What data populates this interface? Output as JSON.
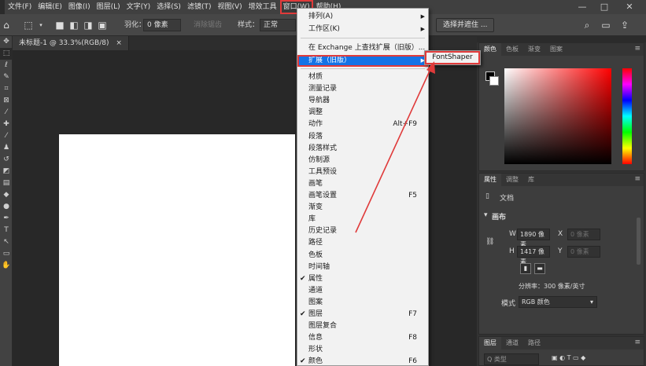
{
  "menubar": {
    "items": [
      "文件(F)",
      "编辑(E)",
      "图像(I)",
      "图层(L)",
      "文字(Y)",
      "选择(S)",
      "滤镜(T)",
      "视图(V)",
      "增效工具",
      "窗口(W)",
      "帮助(H)"
    ],
    "active_index": 9,
    "minimize": "—",
    "maximize": "□",
    "close": "✕"
  },
  "options": {
    "feather_label": "羽化：",
    "feather_value": "0 像素",
    "antialias_label": "消除锯齿",
    "style_label": "样式：",
    "style_value": "正常",
    "select_mask_button": "选择并遮住 ..."
  },
  "document_tab": {
    "label": "未标题-1 @ 33.3%(RGB/8)",
    "close": "×"
  },
  "window_menu": {
    "items": [
      {
        "label": "排列(A)",
        "submenu": true
      },
      {
        "label": "工作区(K)",
        "submenu": true
      },
      {
        "label": "在 Exchange 上查找扩展（旧版）..."
      },
      {
        "label": "扩展（旧版）",
        "submenu": true,
        "highlight": true
      },
      {
        "label": "材质"
      },
      {
        "label": "测量记录"
      },
      {
        "label": "导航器"
      },
      {
        "label": "调整"
      },
      {
        "label": "动作",
        "shortcut": "Alt+F9"
      },
      {
        "label": "段落"
      },
      {
        "label": "段落样式"
      },
      {
        "label": "仿制源"
      },
      {
        "label": "工具预设"
      },
      {
        "label": "画笔"
      },
      {
        "label": "画笔设置",
        "shortcut": "F5"
      },
      {
        "label": "渐变"
      },
      {
        "label": "库"
      },
      {
        "label": "历史记录"
      },
      {
        "label": "路径"
      },
      {
        "label": "色板"
      },
      {
        "label": "时间轴"
      },
      {
        "label": "属性",
        "checked": true
      },
      {
        "label": "通道"
      },
      {
        "label": "图案"
      },
      {
        "label": "图层",
        "checked": true,
        "shortcut": "F7"
      },
      {
        "label": "图层复合"
      },
      {
        "label": "信息",
        "shortcut": "F8"
      },
      {
        "label": "形状"
      },
      {
        "label": "颜色",
        "checked": true,
        "shortcut": "F6"
      }
    ],
    "check_mark": "✔",
    "arrow": "▶"
  },
  "submenu": {
    "item": "FontShaper"
  },
  "color_panel": {
    "tabs": [
      "颜色",
      "色板",
      "渐变",
      "图案"
    ],
    "fg_color": "#000000",
    "bg_color": "#ffffff"
  },
  "properties_panel": {
    "tabs": [
      "属性",
      "调整",
      "库"
    ],
    "doc_label": "文档",
    "canvas_label": "画布",
    "w_label": "W",
    "w_value": "1890 像素",
    "h_label": "H",
    "h_value": "1417 像素",
    "x_label": "X",
    "x_value": "0 像素",
    "y_label": "Y",
    "y_value": "0 像素",
    "resolution": "分辨率：300 像素/英寸",
    "mode_label": "模式",
    "mode_value": "RGB 颜色"
  },
  "layers_panel": {
    "tabs": [
      "图层",
      "通道",
      "路径"
    ],
    "search_placeholder": "Q 类型"
  },
  "colors": {
    "highlight": "#1473e6",
    "annotation_red": "#e03a3a"
  }
}
